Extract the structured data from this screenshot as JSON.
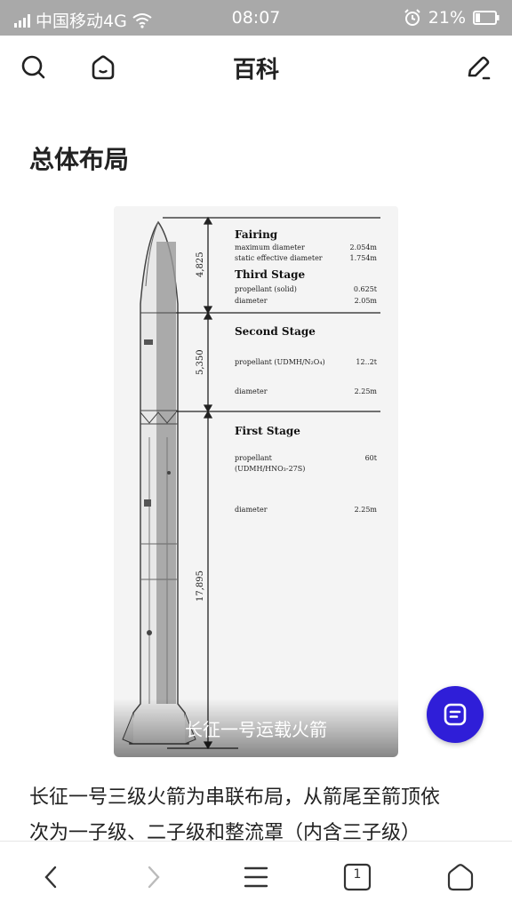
{
  "status": {
    "carrier": "中国移动4G",
    "time": "08:07",
    "battery": "21%"
  },
  "header": {
    "title": "百科"
  },
  "section": {
    "title": "总体布局"
  },
  "figure": {
    "caption": "长征一号运载火箭",
    "dimensions": [
      "4,825",
      "5,350",
      "17,895"
    ],
    "fairing": {
      "title": "Fairing",
      "row1_label": "maximum diameter",
      "row1_value": "2.054m",
      "row2_label": "static effective diameter",
      "row2_value": "1.754m"
    },
    "third_stage": {
      "title": "Third Stage",
      "row1_label": "propellant (solid)",
      "row1_value": "0.625t",
      "row2_label": "diameter",
      "row2_value": "2.05m"
    },
    "second_stage": {
      "title": "Second Stage",
      "row1_label": "propellant (UDMH/N₂O₄)",
      "row1_value": "12..2t",
      "row2_label": "diameter",
      "row2_value": "2.25m"
    },
    "first_stage": {
      "title": "First Stage",
      "row1_label": "propellant",
      "row1_label2": "(UDMH/HNO₃-27S)",
      "row1_value": "60t",
      "row2_label": "diameter",
      "row2_value": "2.25m"
    }
  },
  "article": {
    "line1": "长征一号三级火箭为串联布局，从箭尾至箭顶依",
    "line2": "次为一子级、二子级和整流罩（内含三子级）"
  },
  "bottom_nav": {
    "tab_count": "1"
  }
}
